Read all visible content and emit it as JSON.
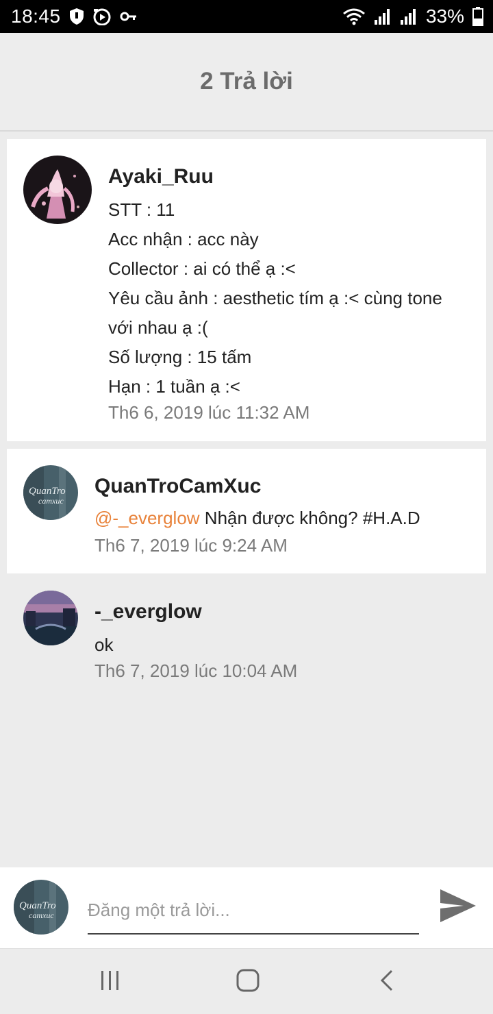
{
  "status_bar": {
    "time": "18:45",
    "battery_percent": "33%",
    "icons": [
      "shield-icon",
      "media-icon",
      "key-icon",
      "wifi-icon",
      "signal-icon",
      "signal-icon",
      "battery-icon"
    ]
  },
  "header": {
    "title": "2 Trả lời"
  },
  "post": {
    "author": "Ayaki_Ruu",
    "lines": [
      "STT : 11",
      "Acc nhận : acc này",
      "Collector : ai có thể ạ :<",
      "Yêu cầu ảnh : aesthetic tím ạ :< cùng tone",
      "với nhau ạ :(",
      "Số lượng : 15 tấm",
      "Hạn : 1 tuần ạ :<"
    ],
    "timestamp": "Th6 6, 2019 lúc 11:32 AM"
  },
  "replies": [
    {
      "author": "QuanTroCamXuc",
      "mention": "@-_everglow",
      "text": " Nhận được không? #H.A.D",
      "timestamp": "Th6 7, 2019 lúc 9:24 AM"
    },
    {
      "author": "-_everglow",
      "text": "ok",
      "timestamp": "Th6 7, 2019 lúc 10:04 AM"
    }
  ],
  "composer": {
    "placeholder": "Đăng một trả lời..."
  },
  "colors": {
    "mention": "#e8823a",
    "background": "#ececec",
    "card": "#ffffff"
  }
}
